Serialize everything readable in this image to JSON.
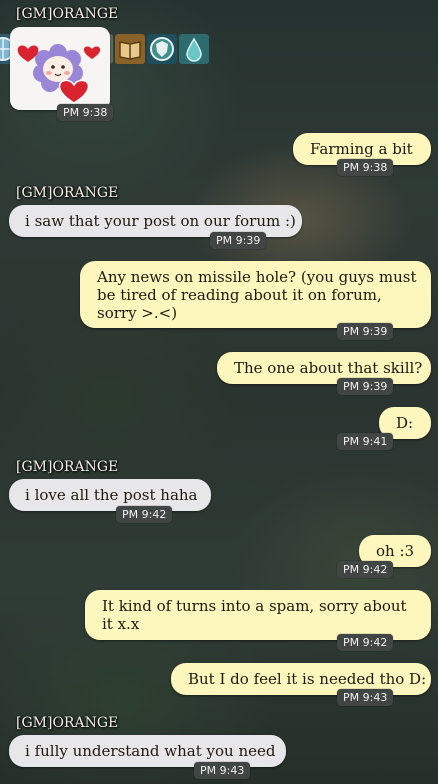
{
  "messages": [
    {
      "sender": "[GM]ORANGE",
      "sticker": "sheep-hearts-sticker",
      "time": "PM 9:38"
    },
    {
      "text": "Farming a bit",
      "time": "PM 9:38"
    },
    {
      "sender": "[GM]ORANGE",
      "text": "i saw that your post on our forum :)",
      "time": "PM 9:39"
    },
    {
      "text": "Any news on missile hole? (you guys must be tired of reading about it on forum, sorry >.<)",
      "time": "PM 9:39"
    },
    {
      "text": "The one about that skill?",
      "time": "PM 9:39"
    },
    {
      "text": "D:",
      "time": "PM 9:41"
    },
    {
      "sender": "[GM]ORANGE",
      "text": "i love all the post haha",
      "time": "PM 9:42"
    },
    {
      "text": "oh :3",
      "time": "PM 9:42"
    },
    {
      "text": "It kind of turns into a spam, sorry about it x.x",
      "time": "PM 9:42"
    },
    {
      "text": "But I do feel it is needed tho D:",
      "time": "PM 9:43"
    },
    {
      "sender": "[GM]ORANGE",
      "text": "i fully understand what you need",
      "time": "PM 9:43"
    }
  ],
  "colors": {
    "incoming_bubble": "#e7e7ea",
    "outgoing_bubble": "#fdf6bd",
    "time_badge": "#414544"
  },
  "icons": [
    "globe-icon",
    "mask-icon",
    "orb-icon",
    "swirl-icon",
    "book-icon",
    "shield-icon",
    "water-drop-icon"
  ]
}
